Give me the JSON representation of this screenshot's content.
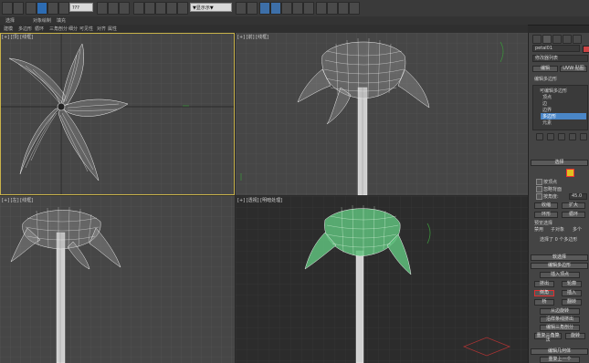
{
  "toolbar": {
    "zoom_value": "???",
    "selection_set": "▼显示示▼"
  },
  "ribbon": {
    "items": [
      "选择",
      "对象绘制",
      "填充"
    ]
  },
  "subribbon": {
    "items": [
      "建模",
      "多边形",
      "循环",
      "三角剖分",
      "细分",
      "可见性",
      "对齐",
      "属性"
    ]
  },
  "viewports": {
    "top": {
      "label": "[+] [顶] [线框]"
    },
    "front": {
      "label": "[+] [前] [线框]"
    },
    "left": {
      "label": "[+] [左] [线框]"
    },
    "persp": {
      "label": "[+] [透视] [明暗处理]"
    }
  },
  "panel": {
    "object_name": "petal01",
    "modifier_list": "修改器列表",
    "subtabs": [
      "编辑",
      "UVW 贴图"
    ],
    "modifier": "编辑多边形",
    "stack_items": [
      "可编辑多边形",
      "顶点",
      "边",
      "边界",
      "多边形",
      "元素"
    ],
    "stack_selected_index": 4,
    "rollout_select": "选择",
    "by_vertex": "按顶点",
    "ignore_back": "忽略背面",
    "by_angle": "按角度:",
    "angle_value": "45.0",
    "shrink": "收缩",
    "grow": "扩大",
    "ring": "环形",
    "loop": "循环",
    "preview": "预览选择",
    "preview_off": "禁用",
    "preview_sub": "子对象",
    "preview_multi": "多个",
    "status_selected": "选择了 0 个多边形",
    "soft_select": "软选择",
    "edit_polys": "编辑多边形",
    "insert_vertex": "插入顶点",
    "extrude": "挤出",
    "outline": "轮廓",
    "bevel": "倒角",
    "inset": "插入",
    "bridge": "桥",
    "flip": "翻转",
    "hinge": "从边旋转",
    "extrude_spline": "沿样条线挤出",
    "edit_tri": "编辑三角剖分",
    "retri": "重复三角算法",
    "turn": "旋转",
    "edit_geo": "编辑几何体",
    "repeat_last": "重复上一个"
  },
  "colors": {
    "panel_accent": "#4a86c7",
    "selected_frame": "#c8b24a",
    "selected_mesh": "#6fd08a",
    "wire": "#e8e8e8"
  }
}
